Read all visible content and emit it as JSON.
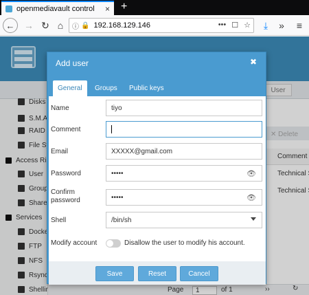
{
  "browser": {
    "tab_title": "openmediavault control",
    "tab_close": "×",
    "new_tab": "+",
    "url": "192.168.129.146",
    "url_extras": [
      "•••",
      "☐",
      "☆"
    ],
    "download_icon": "⤓",
    "overflow_icon": "»",
    "menu_icon": "≡"
  },
  "background": {
    "user_button": "User",
    "delete_label": "✕ Delete",
    "comment_header": "Comment",
    "cells": [
      "Technical S",
      "Technical S"
    ],
    "sidebar": [
      {
        "label": "Disks"
      },
      {
        "label": "S.M.A."
      },
      {
        "label": "RAID M"
      },
      {
        "label": "File Sy"
      },
      {
        "label": "Access Ri"
      },
      {
        "label": "User"
      },
      {
        "label": "Group"
      },
      {
        "label": "Share"
      },
      {
        "label": "Services"
      },
      {
        "label": "Docke"
      },
      {
        "label": "FTP"
      },
      {
        "label": "NFS"
      },
      {
        "label": "Rsync"
      },
      {
        "label": "Shellinabox"
      }
    ],
    "pager": {
      "page_label": "Page",
      "page_value": "1",
      "of_label": "of 1"
    }
  },
  "dialog": {
    "title": "Add user",
    "close": "✖",
    "tabs": [
      "General",
      "Groups",
      "Public keys"
    ],
    "fields": {
      "name": {
        "label": "Name",
        "value": "tiyo"
      },
      "comment": {
        "label": "Comment",
        "value": ""
      },
      "email": {
        "label": "Email",
        "value": "XXXXX@gmail.com"
      },
      "password": {
        "label": "Password",
        "value": "•••••"
      },
      "confirm": {
        "label": "Confirm password",
        "value": "•••••"
      },
      "shell": {
        "label": "Shell",
        "value": "/bin/sh"
      },
      "modify": {
        "label": "Modify account",
        "toggle_text": "Disallow the user to modify his account."
      }
    },
    "buttons": {
      "save": "Save",
      "reset": "Reset",
      "cancel": "Cancel"
    }
  }
}
